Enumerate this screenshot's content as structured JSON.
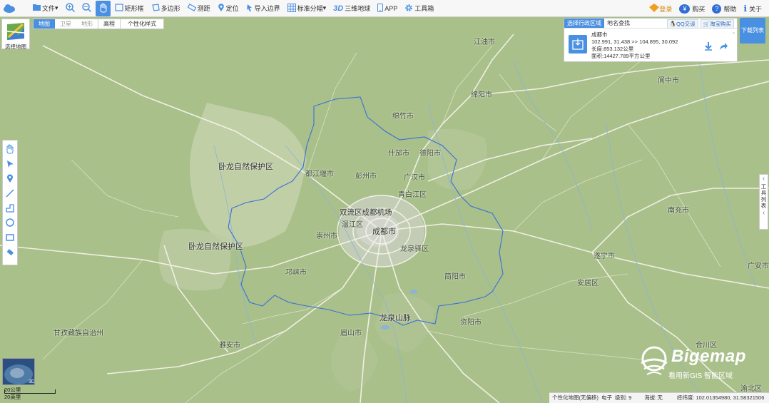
{
  "toolbar": {
    "items": [
      {
        "label": "文件",
        "icon": "folder-icon"
      },
      {
        "label": "",
        "icon": "zoom-in-icon"
      },
      {
        "label": "",
        "icon": "zoom-out-icon"
      },
      {
        "label": "",
        "icon": "hand-pan-icon"
      },
      {
        "label": "矩形框",
        "icon": "rectangle-select-icon"
      },
      {
        "label": "多边形",
        "icon": "polygon-icon"
      },
      {
        "label": "测距",
        "icon": "ruler-icon"
      },
      {
        "label": "定位",
        "icon": "location-pin-icon"
      },
      {
        "label": "导入边界",
        "icon": "import-boundary-icon"
      },
      {
        "label": "标准分幅",
        "icon": "grid-icon"
      },
      {
        "label": "三维地球",
        "icon": "3d-icon"
      },
      {
        "label": "APP",
        "icon": "phone-icon"
      },
      {
        "label": "工具箱",
        "icon": "gear-icon"
      }
    ],
    "right": {
      "login": "登录",
      "buy": "购买",
      "help": "帮助",
      "about": "关于"
    }
  },
  "layer_tabs": {
    "map": "地图",
    "satellite": "卫星",
    "terrain": "地形",
    "elevation": "高程",
    "custom": "个性化样式"
  },
  "select_map": {
    "label": "选择地图"
  },
  "region_panel": {
    "tab_admin": "选择行政区域",
    "tab_search": "地名查找",
    "qq_btn": "QQ交谈",
    "taobao_btn": "淘宝购买",
    "name": "成都市",
    "coords": "102.991, 31.438  >> 104.895, 30.092",
    "perimeter": "长度:853.132公里",
    "area": "面积:14427.789平方公里"
  },
  "download_list": "下载列表",
  "side_tool": {
    "label": "工具列表"
  },
  "map_labels": {
    "jiangyou": "江油市",
    "mianyang": "绵阳市",
    "langzhong": "阆中市",
    "mianzhu": "绵竹市",
    "shifang": "什邡市",
    "deyang": "德阳市",
    "wolong1": "卧龙自然保护区",
    "wolong2": "卧龙自然保护区",
    "dujiangyan": "都江堰市",
    "pengzhou": "彭州市",
    "guanghan": "广汉市",
    "qingbaijiang": "青白江区",
    "nanchong": "南充市",
    "shuangliu": "双流区成都机场",
    "wenjiang": "温江区",
    "chengdu": "成都市",
    "chongzhou": "崇州市",
    "longquanyi": "龙泉驿区",
    "suining": "遂宁市",
    "guangan": "广安市",
    "qionglai": "邛崃市",
    "jianyang": "简阳市",
    "anju": "安居区",
    "longquanshan": "龙泉山脉",
    "ziyang": "资阳市",
    "meishan": "眉山市",
    "yaan": "雅安市",
    "ganzi": "甘孜藏族自治州",
    "hechuan": "合川区",
    "yuzhong": "渝北区"
  },
  "bigemap": {
    "name": "Bigemap",
    "slogan": "看用新GIS 智能区域"
  },
  "scale": {
    "km": "20公里",
    "mi": "20英里"
  },
  "status": {
    "custom_map": "个性化地图(无偏移)",
    "source": "电子",
    "level_label": "级别:",
    "level": "9",
    "altitude_label": "海拔:",
    "altitude": "无",
    "lnglat_label": "经纬度:",
    "lnglat": "102.01354980, 31.58321506"
  },
  "colors": {
    "accent": "#4a90e2",
    "boundary": "#3a6fd8",
    "land": "#a9c08a"
  }
}
